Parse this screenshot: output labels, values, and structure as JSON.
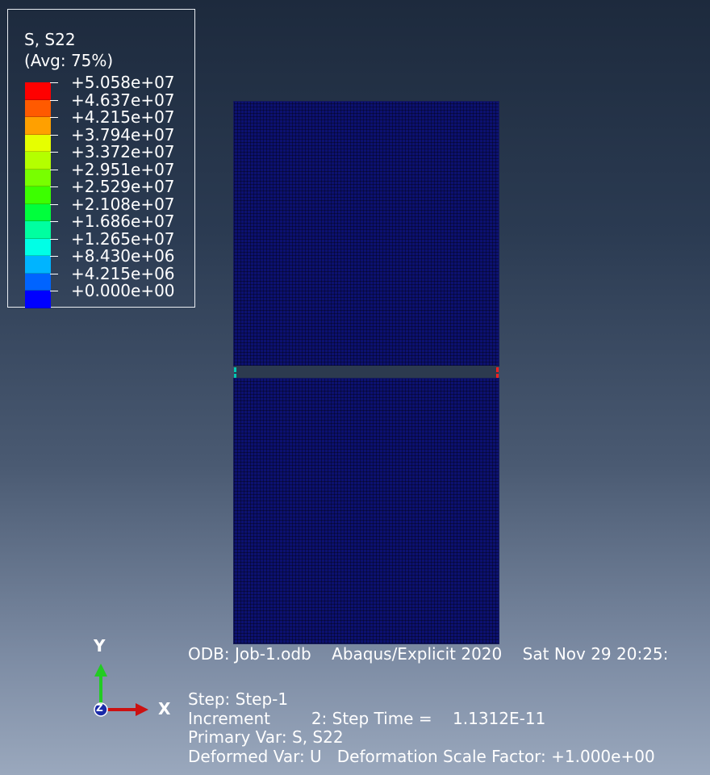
{
  "legend": {
    "title": "S, S22",
    "subtitle": "(Avg: 75%)",
    "levels": [
      {
        "label": "+5.058e+07",
        "color": "#ff0000"
      },
      {
        "label": "+4.637e+07",
        "color": "#ff5a00"
      },
      {
        "label": "+4.215e+07",
        "color": "#ffa000"
      },
      {
        "label": "+3.794e+07",
        "color": "#e6ff00"
      },
      {
        "label": "+3.372e+07",
        "color": "#b4ff00"
      },
      {
        "label": "+2.951e+07",
        "color": "#78ff00"
      },
      {
        "label": "+2.529e+07",
        "color": "#3cff00"
      },
      {
        "label": "+2.108e+07",
        "color": "#00ff3c"
      },
      {
        "label": "+1.686e+07",
        "color": "#00ffa0"
      },
      {
        "label": "+1.265e+07",
        "color": "#00ffe6"
      },
      {
        "label": "+8.430e+06",
        "color": "#00b4ff"
      },
      {
        "label": "+4.215e+06",
        "color": "#0064ff"
      },
      {
        "label": "+0.000e+00",
        "color": "#0000ff"
      }
    ]
  },
  "triad": {
    "y_label": "Y",
    "x_label": "X",
    "z_label": "Z",
    "y_color": "#22cc22",
    "x_color": "#cc1111",
    "z_color": "#1a2aa8"
  },
  "model": {
    "fill_color": "#0c1170",
    "crack_color": "#2c3a4f"
  },
  "info": {
    "odb_line": "ODB: Job-1.odb    Abaqus/Explicit 2020    Sat Nov 29 20:25:",
    "step_line": "Step: Step-1",
    "increment_line": "Increment        2: Step Time =    1.1312E-11",
    "primary_var_line": "Primary Var: S, S22",
    "deformed_var_line": "Deformed Var: U   Deformation Scale Factor: +1.000e+00"
  }
}
